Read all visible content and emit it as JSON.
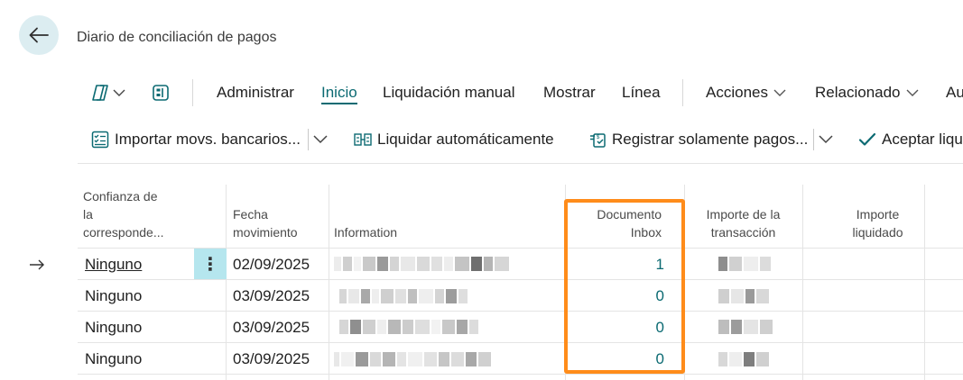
{
  "page": {
    "title": "Diario de conciliación de pagos"
  },
  "menubar": {
    "items": [
      {
        "label": "Administrar",
        "active": false,
        "chevron": false
      },
      {
        "label": "Inicio",
        "active": true,
        "chevron": false
      },
      {
        "label": "Liquidación manual",
        "active": false,
        "chevron": false
      },
      {
        "label": "Mostrar",
        "active": false,
        "chevron": false
      },
      {
        "label": "Línea",
        "active": false,
        "chevron": false
      },
      {
        "label": "Acciones",
        "active": false,
        "chevron": true
      },
      {
        "label": "Relacionado",
        "active": false,
        "chevron": true
      },
      {
        "label": "Au",
        "active": false,
        "chevron": false
      }
    ]
  },
  "actions": {
    "import": "Importar movs. bancarios...",
    "auto": "Liquidar automáticamente",
    "register": "Registrar solamente pagos...",
    "accept": "Aceptar liqu"
  },
  "table": {
    "headers": {
      "confidence": [
        "Confianza de",
        "la",
        "corresponde..."
      ],
      "date": [
        "Fecha",
        "movimiento"
      ],
      "info": [
        "Information"
      ],
      "docinbox": [
        "Documento",
        "Inbox"
      ],
      "amount": [
        "Importe de la",
        "transacción"
      ],
      "liquidated": [
        "Importe",
        "liquidado"
      ]
    },
    "rows": [
      {
        "confidence": "Ninguno",
        "date": "02/09/2025",
        "docinbox": "1",
        "selected": true
      },
      {
        "confidence": "Ninguno",
        "date": "03/09/2025",
        "docinbox": "0",
        "selected": false
      },
      {
        "confidence": "Ninguno",
        "date": "03/09/2025",
        "docinbox": "0",
        "selected": false
      },
      {
        "confidence": "Ninguno",
        "date": "03/09/2025",
        "docinbox": "0",
        "selected": false
      }
    ]
  },
  "colors": {
    "accent": "#0b6a72",
    "highlight": "#ff8c1a",
    "selected_cell": "#b5e6ee"
  }
}
